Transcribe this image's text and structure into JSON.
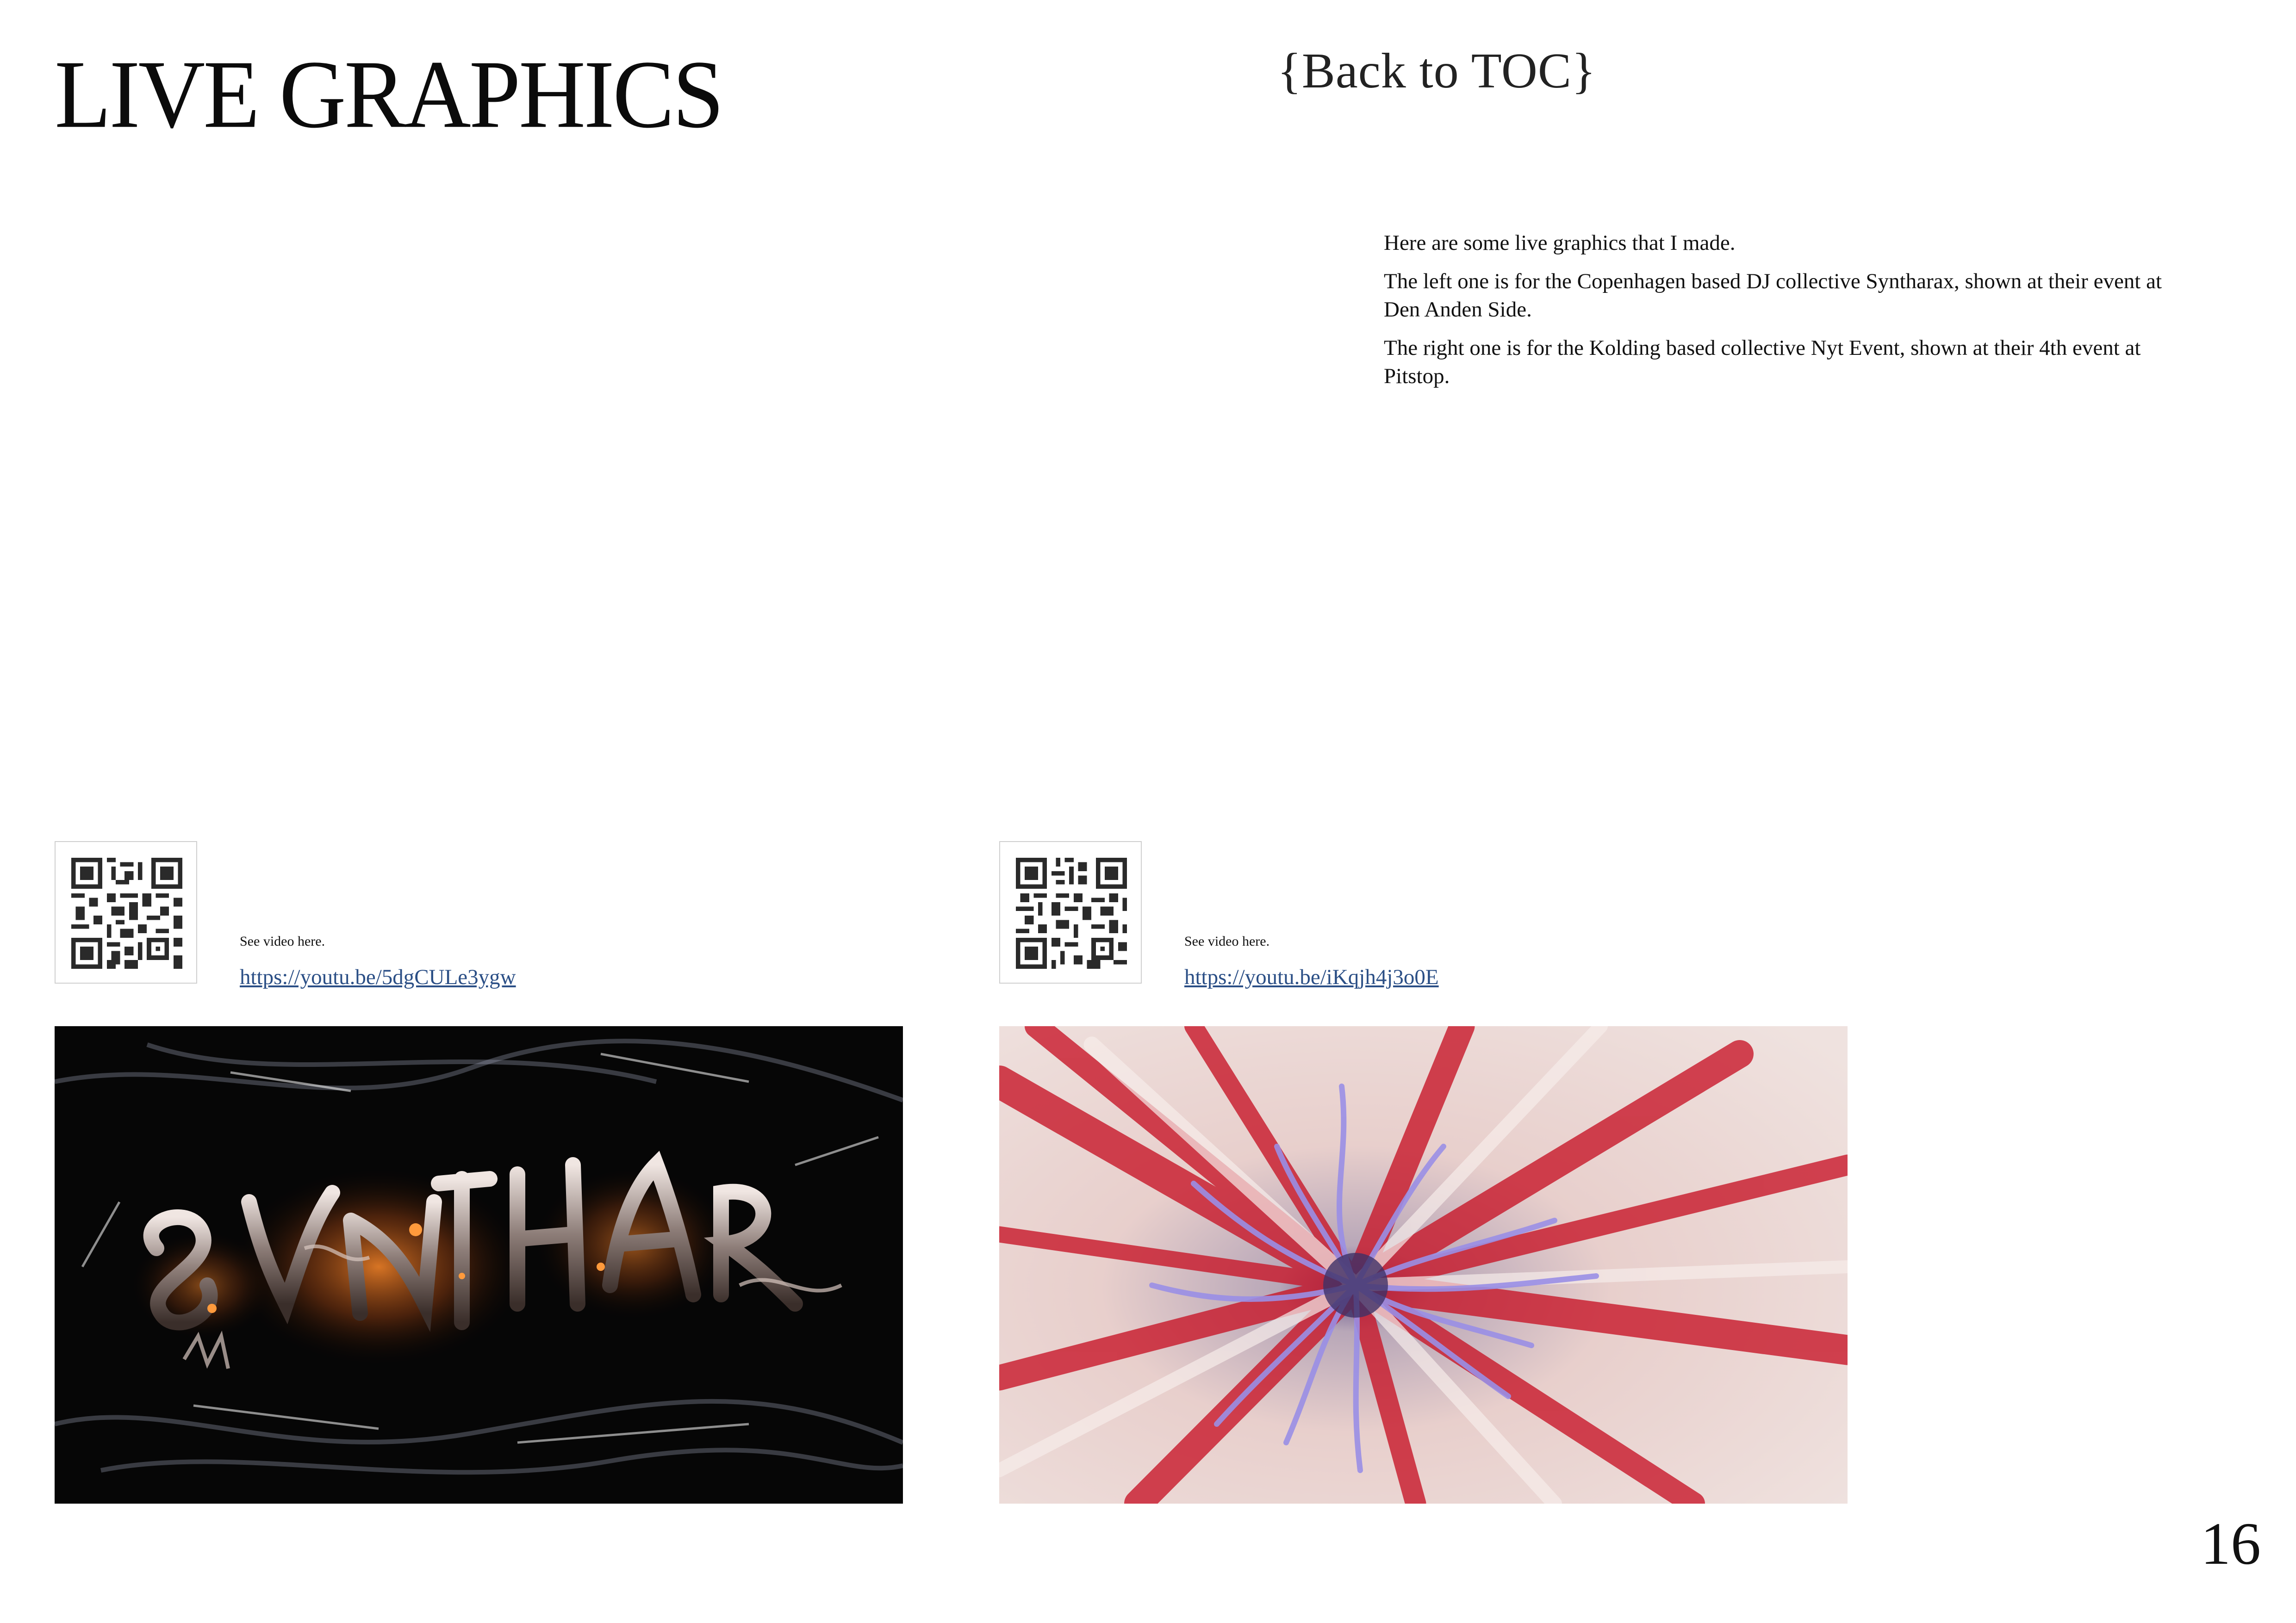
{
  "header": {
    "title": "LIVE GRAPHICS",
    "back_link": "{Back to TOC}"
  },
  "intro": {
    "paragraphs": [
      "Here are some live graphics that I made.",
      "The left one is for the Copenhagen based DJ collective Syntharax, shown at their event at Den Anden Side.",
      "The right one is for the Kolding based collective Nyt Event, shown at their 4th event at Pitstop."
    ]
  },
  "videos": [
    {
      "caption": "See video here.",
      "url": "https://youtu.be/5dgCULe3ygw",
      "image": "syntharax-chrome-lettering-render"
    },
    {
      "caption": "See video here.",
      "url": "https://youtu.be/iKqjh4j3o0E",
      "image": "red-white-flower-render"
    }
  ],
  "footer": {
    "page_number": "16"
  },
  "colors": {
    "link": "#2b4f86",
    "text": "#111111",
    "background": "#ffffff"
  }
}
